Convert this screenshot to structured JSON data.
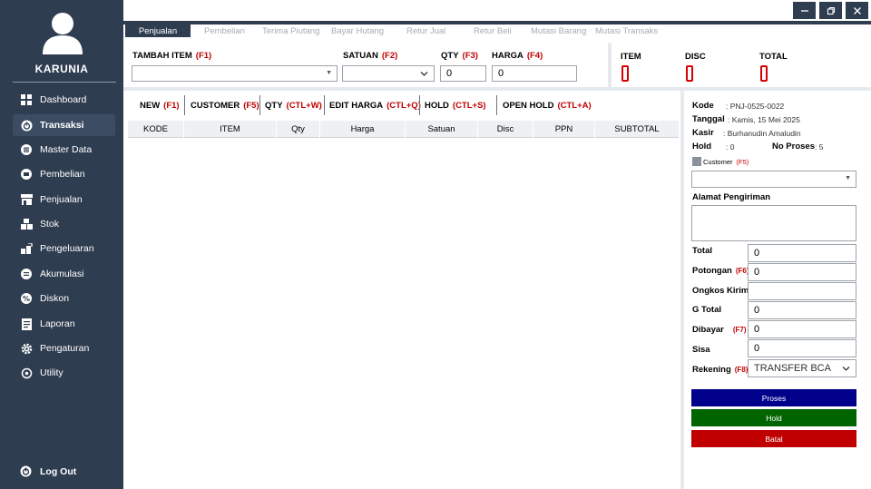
{
  "brand": "KARUNIA",
  "sidebar": {
    "items": [
      {
        "label": "Dashboard",
        "icon": "dashboard-grid-icon"
      },
      {
        "label": "Transaksi",
        "icon": "transaksi-power-icon"
      },
      {
        "label": "Master Data",
        "icon": "database-icon"
      },
      {
        "label": "Pembelian",
        "icon": "wallet-icon"
      },
      {
        "label": "Penjualan",
        "icon": "store-icon"
      },
      {
        "label": "Stok",
        "icon": "boxes-icon"
      },
      {
        "label": "Pengeluaran",
        "icon": "expense-icon"
      },
      {
        "label": "Akumulasi",
        "icon": "accumulation-icon"
      },
      {
        "label": "Diskon",
        "icon": "discount-icon"
      },
      {
        "label": "Laporan",
        "icon": "report-icon"
      },
      {
        "label": "Pengaturan",
        "icon": "gear-icon"
      },
      {
        "label": "Utility",
        "icon": "utility-icon"
      }
    ],
    "logout": "Log Out"
  },
  "tabs": [
    "Penjualan",
    "Pembelian",
    "Terima Piutang",
    "Bayar Hutang",
    "Retur Jual",
    "Retur Beli",
    "Mutasi Barang",
    "Mutasi Transaks"
  ],
  "form": {
    "tambah_item": {
      "label": "TAMBAH ITEM",
      "key": "(F1)",
      "value": ""
    },
    "satuan": {
      "label": "SATUAN",
      "key": "(F2)",
      "value": ""
    },
    "qty": {
      "label": "QTY",
      "key": "(F3)",
      "value": "0"
    },
    "harga": {
      "label": "HARGA",
      "key": "(F4)",
      "value": "0"
    }
  },
  "stats": {
    "item_label": "ITEM",
    "disc_label": "DISC",
    "total_label": "TOTAL"
  },
  "actions": [
    {
      "label": "NEW",
      "key": "(F1)"
    },
    {
      "label": "CUSTOMER",
      "key": "(F5)"
    },
    {
      "label": "QTY",
      "key": "(CTL+W)"
    },
    {
      "label": "EDIT HARGA",
      "key": "(CTL+Q)"
    },
    {
      "label": "HOLD",
      "key": "(CTL+S)"
    },
    {
      "label": "OPEN HOLD",
      "key": "(CTL+A)"
    }
  ],
  "table": {
    "columns": [
      "KODE",
      "ITEM",
      "Qty",
      "Harga",
      "Satuan",
      "Disc",
      "PPN",
      "SUBTOTAL"
    ],
    "rows": []
  },
  "info": {
    "kode_label": "Kode",
    "kode": "PNJ-0525-0022",
    "tanggal_label": "Tanggal",
    "tanggal": "Kamis, 15 Mei 2025",
    "kasir_label": "Kasir",
    "kasir": "Burhanudin Amaludin",
    "hold_label": "Hold",
    "hold": "0",
    "no_proses_label": "No Proses",
    "no_proses": "5",
    "customer_label": "Customer",
    "customer_key": "(F5)",
    "customer_value": "",
    "alamat_label": "Alamat Pengiriman",
    "alamat_value": ""
  },
  "totals": {
    "total_label": "Total",
    "total": "0",
    "potongan_label": "Potongan",
    "potongan_key": "(F6)",
    "potongan": "0",
    "ongkos_label": "Ongkos Kirim",
    "ongkos": "",
    "gtotal_label": "G Total",
    "gtotal": "0",
    "dibayar_label": "Dibayar",
    "dibayar_key": "(F7)",
    "dibayar": "0",
    "sisa_label": "Sisa",
    "sisa": "0",
    "rekening_label": "Rekening",
    "rekening_key": "(F8)",
    "rekening": "TRANSFER BCA"
  },
  "buttons": {
    "proses": "Proses",
    "hold": "Hold",
    "batal": "Batal"
  },
  "colors": {
    "sidebar": "#2f3d51",
    "proses": "#00008b",
    "hold": "#006400",
    "batal": "#c00000",
    "hotkey": "#c00000"
  }
}
